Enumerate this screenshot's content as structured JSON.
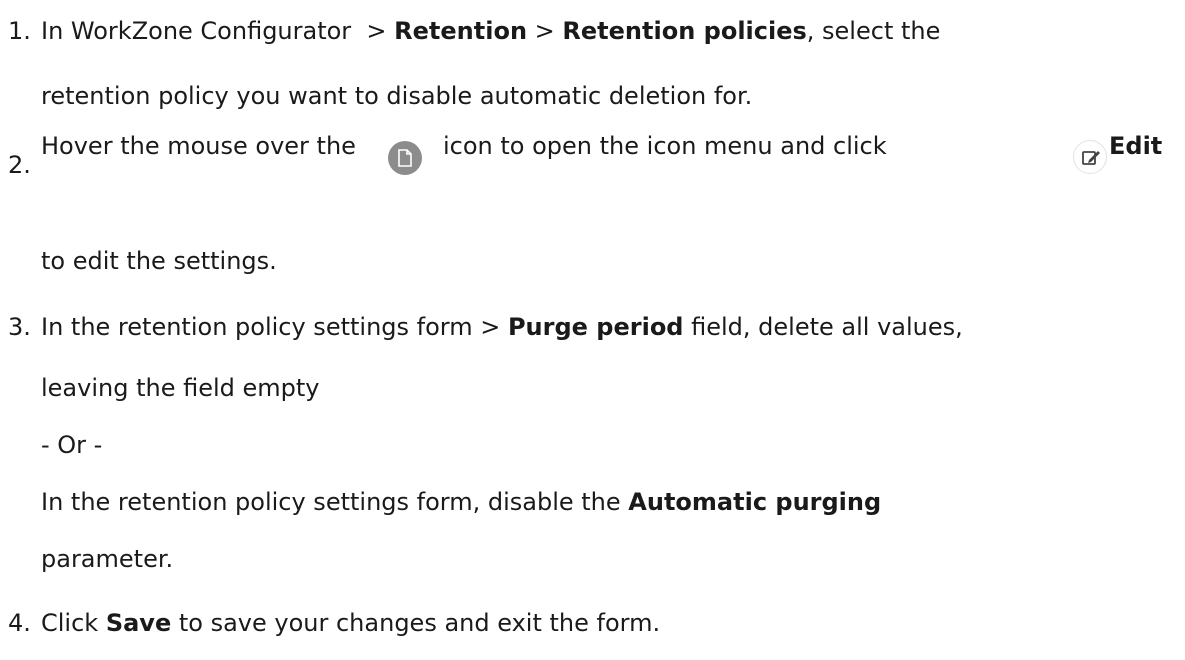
{
  "steps": [
    {
      "number": "1.",
      "line1_pre": "In WorkZone Configurator  > ",
      "line1_b1": "Retention",
      "line1_mid": " > ",
      "line1_b2": "Retention policies",
      "line1_post": ", select the",
      "line2": "retention policy you want to disable automatic deletion for."
    },
    {
      "number": "2.",
      "text_a": "Hover the mouse over the",
      "text_b": "icon to open the icon menu and click",
      "edit_label": "Edit",
      "icon_a": "document-icon",
      "icon_b": "edit-icon",
      "line2": "to edit the settings."
    },
    {
      "number": "3.",
      "line1_pre": "In the retention policy settings form > ",
      "line1_b": "Purge period",
      "line1_post": " field, delete all values,",
      "line2": "leaving the field empty",
      "or": "- Or -",
      "line4": "In the retention policy settings form, disable the ",
      "line4_b": "Automatic purging",
      "line5": "parameter."
    },
    {
      "number": "4.",
      "pre": "Click ",
      "bold": "Save",
      "post": " to save your changes and exit the form."
    }
  ]
}
